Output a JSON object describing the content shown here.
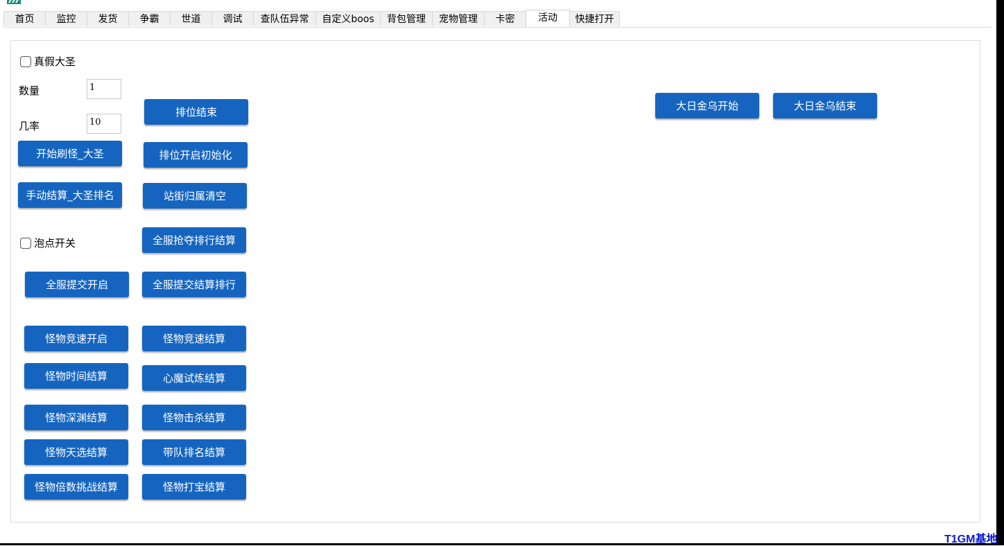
{
  "tabs": [
    "首页",
    "监控",
    "发货",
    "争霸",
    "世道",
    "调试",
    "查队伍异常",
    "自定义boos",
    "背包管理",
    "宠物管理",
    "卡密",
    "活动",
    "快捷打开"
  ],
  "active_tab": "活动",
  "form": {
    "fake_monkey_label": "真假大圣",
    "quantity_label": "数量",
    "quantity_value": "1",
    "probability_label": "几率",
    "probability_value": "10",
    "bubble_label": "泡点开关"
  },
  "buttons": {
    "rank_end": "排位结束",
    "start_monsters": "开始刷怪_大圣",
    "rank_open_init": "排位开启初始化",
    "manual_settle": "手动结算_大圣排名",
    "clear_street": "站街归属清空",
    "server_loot_settle": "全服抢夺排行结算",
    "server_submit_open": "全服提交开启",
    "server_submit_settle": "全服提交结算排行",
    "monster_race_open": "怪物竞速开启",
    "monster_race_settle": "怪物竞速结算",
    "monster_time_settle": "怪物时间结算",
    "heart_demon_settle": "心魔试炼结算",
    "monster_abyss_settle": "怪物深渊结算",
    "monster_kill_settle": "怪物击杀结算",
    "monster_choice_settle": "怪物天选结算",
    "team_rank_settle": "带队排名结算",
    "monster_multi_settle": "怪物倍数挑战结算",
    "monster_treasure_settle": "怪物打宝结算",
    "sun_crow_start": "大日金乌开始",
    "sun_crow_end": "大日金乌结束"
  },
  "watermark": "T1GM基地",
  "colors": {
    "button": "#1565c0",
    "watermark": "#0a18d6"
  }
}
